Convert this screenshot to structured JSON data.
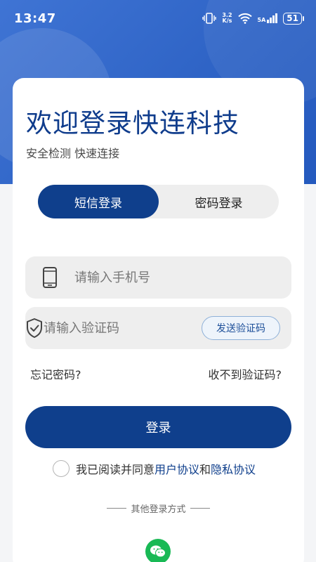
{
  "status_bar": {
    "time": "13:47",
    "net_speed_value": "3.2",
    "net_speed_unit": "K/s",
    "signal_label": "5A",
    "battery": "51"
  },
  "header": {
    "title": "欢迎登录快连科技",
    "subtitle": "安全检测 快速连接"
  },
  "tabs": [
    {
      "label": "短信登录",
      "active": true
    },
    {
      "label": "密码登录",
      "active": false
    }
  ],
  "form": {
    "phone_placeholder": "请输入手机号",
    "code_placeholder": "请输入验证码",
    "send_code_label": "发送验证码",
    "forgot_password": "忘记密码?",
    "no_code": "收不到验证码?",
    "login_label": "登录"
  },
  "agreement": {
    "prefix": "我已阅读并同意",
    "user_agreement": "用户协议",
    "and": "和",
    "privacy_policy": "隐私协议",
    "checked": false
  },
  "other_login": {
    "label": "其他登录方式",
    "methods": [
      "wechat-icon"
    ]
  },
  "colors": {
    "brand": "#0f3f8c",
    "header_blue": "#2f64c6",
    "wechat_green": "#19b955"
  }
}
